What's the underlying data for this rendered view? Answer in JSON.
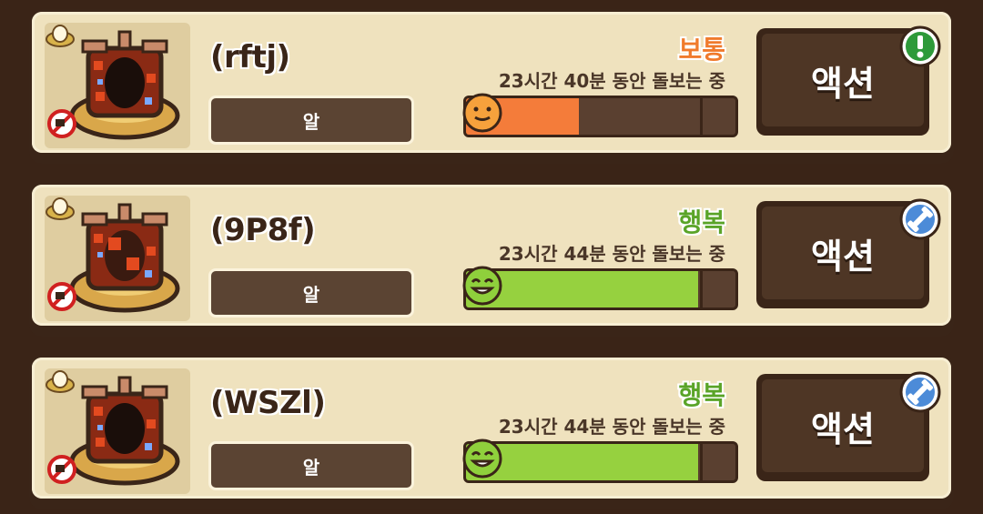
{
  "colors": {
    "mood_normal": "#f07a2c",
    "mood_happy": "#5aa428",
    "bar_orange": "#f47c3a",
    "bar_green": "#96d13f"
  },
  "pets": [
    {
      "name": "(rftj)",
      "type": "알",
      "mood": "보통",
      "mood_color": "#f07a2c",
      "care_time": "23시간 40분 동안 돌보는 중",
      "fill": 0.42,
      "fill_color": "#f47c3a",
      "face": "neutral-face-icon",
      "action": "액션",
      "badge": "alert-badge-icon"
    },
    {
      "name": "(9P8f)",
      "type": "알",
      "mood": "행복",
      "mood_color": "#5aa428",
      "care_time": "23시간 44분 동안 돌보는 중",
      "fill": 0.86,
      "fill_color": "#96d13f",
      "face": "happy-face-icon",
      "action": "액션",
      "badge": "dumbbell-badge-icon"
    },
    {
      "name": "(WSZl)",
      "type": "알",
      "mood": "행복",
      "mood_color": "#5aa428",
      "care_time": "23시간 44분 동안 돌보는 중",
      "fill": 0.86,
      "fill_color": "#96d13f",
      "face": "happy-face-icon",
      "action": "액션",
      "badge": "dumbbell-badge-icon"
    }
  ]
}
